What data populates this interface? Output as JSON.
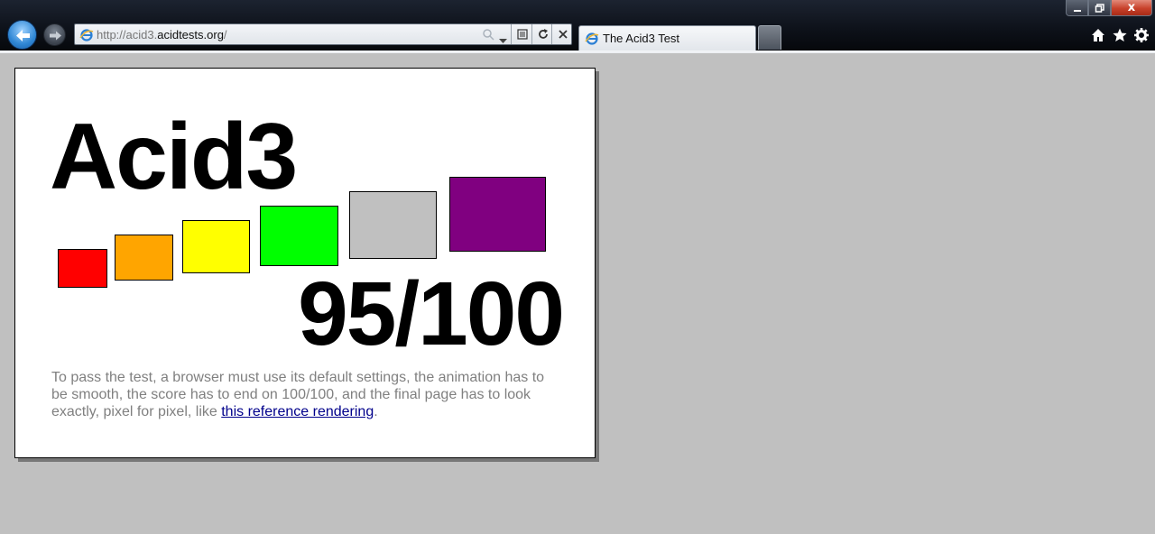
{
  "browser": {
    "window_buttons": {
      "minimize": "",
      "restore": "",
      "close": "x"
    },
    "address_bar": {
      "url_prefix": "http://acid3.",
      "url_domain": "acidtests.org",
      "url_suffix": "/"
    },
    "tab": {
      "title": "The Acid3 Test"
    },
    "icons": [
      "back-arrow-icon",
      "forward-arrow-icon",
      "ie-page-icon",
      "search-icon",
      "dropdown-arrow-icon",
      "compatibility-view-icon",
      "refresh-icon",
      "stop-icon",
      "home-icon",
      "favorites-star-icon",
      "tools-gear-icon"
    ]
  },
  "page": {
    "title": "Acid3",
    "buckets": [
      {
        "name": "bucket-1",
        "color": "#ff0000"
      },
      {
        "name": "bucket-2",
        "color": "#ffa500"
      },
      {
        "name": "bucket-3",
        "color": "#ffff00"
      },
      {
        "name": "bucket-4",
        "color": "#00ff00"
      },
      {
        "name": "bucket-5",
        "color": "#c0c0c0"
      },
      {
        "name": "bucket-6",
        "color": "#800080"
      }
    ],
    "score": "95/100",
    "instructions": {
      "text": "To pass the test, a browser must use its default settings, the animation has to be smooth, the score has to end on 100/100, and the final page has to look exactly, pixel for pixel, like",
      "link_text": "this reference rendering",
      "after_link": "."
    },
    "background_color": "#c0c0c0"
  }
}
